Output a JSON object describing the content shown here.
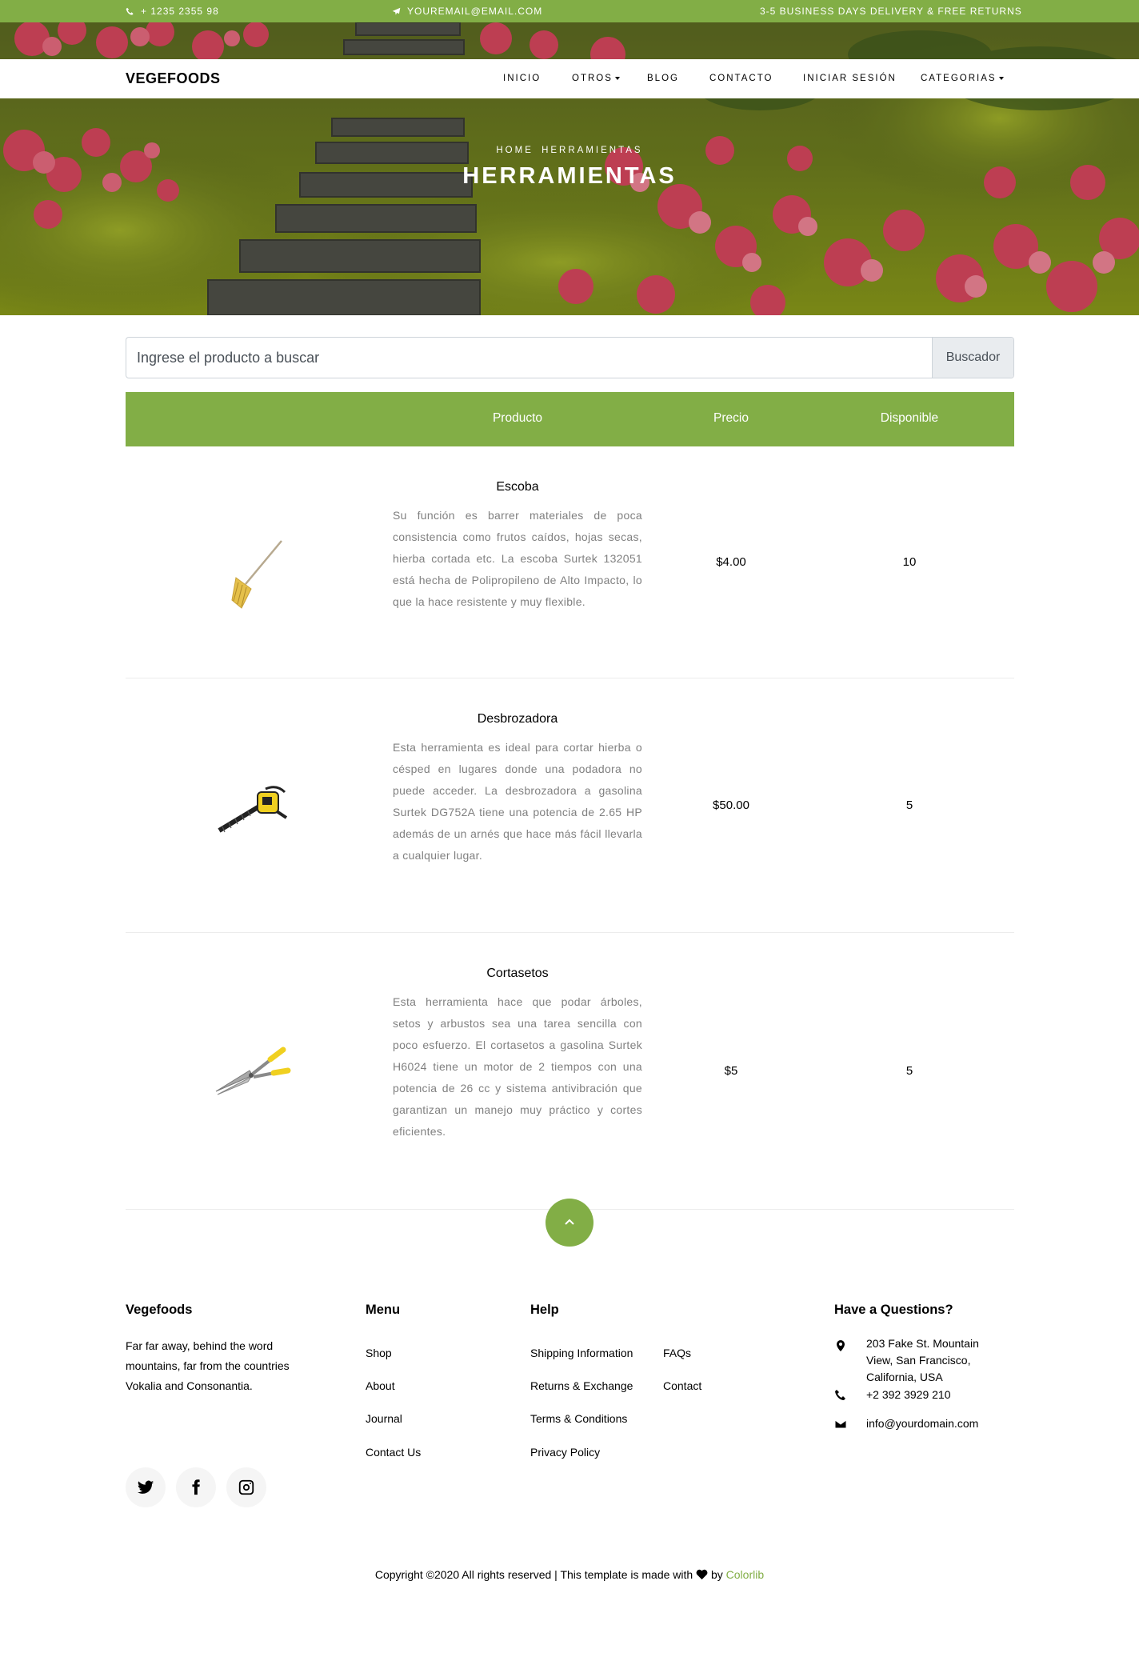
{
  "topbar": {
    "phone": "+ 1235 2355 98",
    "email": "YOUREMAIL@EMAIL.COM",
    "delivery": "3-5 BUSINESS DAYS DELIVERY & FREE RETURNS"
  },
  "navbar": {
    "brand": "VEGEFOODS",
    "items": [
      {
        "label": "INICIO"
      },
      {
        "label": "OTROS"
      },
      {
        "label": "BLOG"
      },
      {
        "label": "CONTACTO"
      },
      {
        "label": "INICIAR SESIÓN"
      },
      {
        "label": "CATEGORIAS"
      }
    ]
  },
  "hero": {
    "breadcrumb": [
      "HOME",
      "HERRAMIENTAS"
    ],
    "title": "HERRAMIENTAS"
  },
  "search": {
    "placeholder": "Ingrese el producto a buscar",
    "button": "Buscador"
  },
  "table": {
    "headers": [
      "Producto",
      "Precio",
      "Disponible"
    ],
    "rows": [
      {
        "name": "Escoba",
        "description": "Su función es barrer materiales de poca consistencia como frutos caídos, hojas secas, hierba cortada etc. La escoba Surtek 132051 está hecha de Polipropileno de Alto Impacto, lo que la hace resistente y muy flexible.",
        "price": "$4.00",
        "available": "10",
        "image_icon": "rake-icon"
      },
      {
        "name": "Desbrozadora",
        "description": "Esta herramienta es ideal para cortar hierba o césped en lugares donde una podadora no puede acceder. La desbrozadora a gasolina Surtek DG752A tiene una potencia de 2.65 HP además de un arnés que hace más fácil llevarla a cualquier lugar.",
        "price": "$50.00",
        "available": "5",
        "image_icon": "hedge-trimmer-icon"
      },
      {
        "name": "Cortasetos",
        "description": "Esta herramienta hace que podar árboles, setos y arbustos sea una tarea sencilla con poco esfuerzo. El cortasetos a gasolina Surtek H6024 tiene un motor de 2 tiempos con una potencia de 26 cc y sistema antivibración que garantizan un manejo muy práctico y cortes eficientes.",
        "price": "$5",
        "available": "5",
        "image_icon": "hedge-shears-icon"
      }
    ]
  },
  "footer": {
    "brand": {
      "title": "Vegefoods",
      "text": "Far far away, behind the word mountains, far from the countries Vokalia and Consonantia."
    },
    "menu": {
      "title": "Menu",
      "links": [
        "Shop",
        "About",
        "Journal",
        "Contact Us"
      ]
    },
    "help": {
      "title": "Help",
      "links_col1": [
        "Shipping Information",
        "Returns & Exchange",
        "Terms & Conditions",
        "Privacy Policy"
      ],
      "links_col2": [
        "FAQs",
        "Contact"
      ]
    },
    "questions": {
      "title": "Have a Questions?",
      "address": "203 Fake St. Mountain View, San Francisco, California, USA",
      "phone": "+2 392 3929 210",
      "email": "info@yourdomain.com"
    },
    "copyright_before": "Copyright ©2020 All rights reserved | This template is made with",
    "copyright_by": "by",
    "copyright_link": "Colorlib"
  },
  "colors": {
    "accent": "#82ae46",
    "text_muted": "#808080"
  }
}
